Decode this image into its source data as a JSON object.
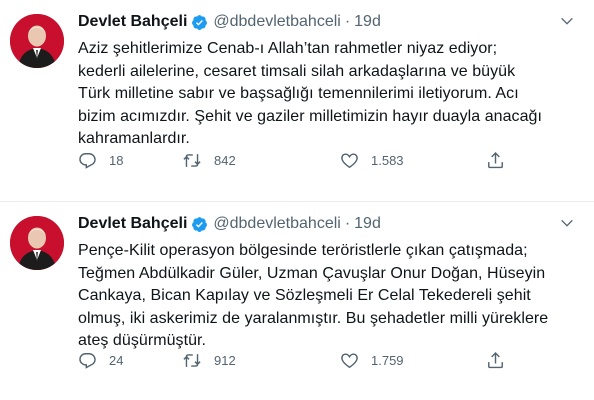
{
  "tweets": [
    {
      "author": "Devlet Bahçeli",
      "handle": "@dbdevletbahceli",
      "separator": "·",
      "time": "19d",
      "lines": [
        "Aziz şehitlerimize Cenab-ı Allah’tan rahmetler niyaz ediyor;",
        "kederli ailelerine, cesaret timsali silah arkadaşlarına ve büyük",
        "Türk milletine sabır ve başsağlığı temennilerimi iletiyorum. Acı",
        "bizim acımızdır. Şehit ve gaziler milletimizin hayır duayla anacağı",
        "kahramanlardır."
      ],
      "replies": "18",
      "retweets": "842",
      "likes": "1.583"
    },
    {
      "author": "Devlet Bahçeli",
      "handle": "@dbdevletbahceli",
      "separator": "·",
      "time": "19d",
      "lines": [
        "Pençe-Kilit operasyon bölgesinde teröristlerle çıkan çatışmada;",
        "Teğmen Abdülkadir Güler, Uzman Çavuşlar Onur Doğan, Hüseyin",
        "Cankaya, Bican Kapılay ve Sözleşmeli Er Celal Tekedereli şehit",
        "olmuş, iki askerimiz de yaralanmıştır. Bu şehadetler milli yüreklere",
        "ateş düşürmüştür."
      ],
      "replies": "24",
      "retweets": "912",
      "likes": "1.759"
    }
  ],
  "icons": {
    "verified": "verified-badge-icon",
    "more": "chevron-down-icon",
    "reply": "reply-icon",
    "retweet": "retweet-icon",
    "like": "heart-icon",
    "share": "share-icon"
  },
  "colors": {
    "verified": "#1d9bf0",
    "text": "#0f1419",
    "muted": "#536471",
    "divider": "#e6ecf0",
    "avatar_bg": "#c8102e"
  }
}
